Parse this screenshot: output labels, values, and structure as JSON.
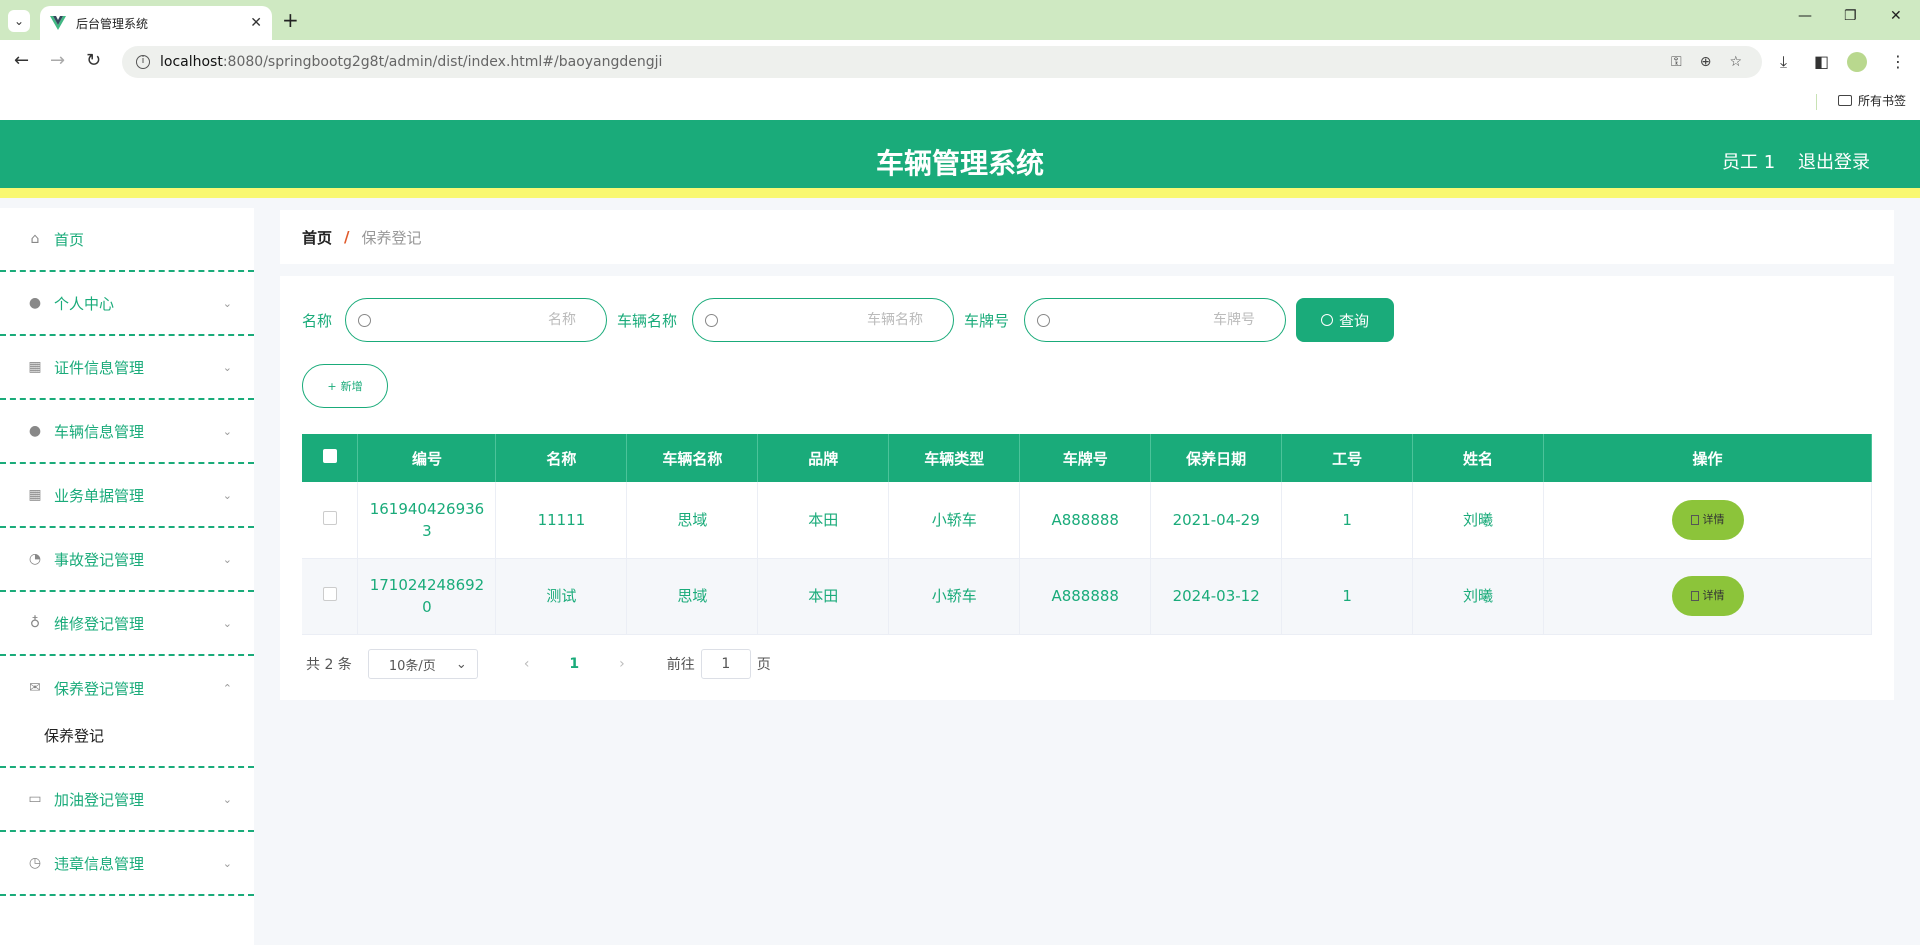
{
  "browser": {
    "tab_title": "后台管理系统",
    "url_host": "localhost",
    "url_path": ":8080/springbootg2g8t/admin/dist/index.html#/baoyangdengji",
    "bookmarks_label": "所有书签"
  },
  "header": {
    "title": "车辆管理系统",
    "user": "员工 1",
    "logout": "退出登录"
  },
  "sidebar": {
    "items": [
      {
        "label": "首页",
        "icon": "home-icon"
      },
      {
        "label": "个人中心",
        "icon": "user-icon"
      },
      {
        "label": "证件信息管理",
        "icon": "grid-icon"
      },
      {
        "label": "车辆信息管理",
        "icon": "user-icon"
      },
      {
        "label": "业务单据管理",
        "icon": "grid-icon"
      },
      {
        "label": "事故登记管理",
        "icon": "gauge-icon"
      },
      {
        "label": "维修登记管理",
        "icon": "mic-icon"
      },
      {
        "label": "保养登记管理",
        "icon": "mail-icon"
      },
      {
        "label": "加油登记管理",
        "icon": "chat-icon"
      },
      {
        "label": "违章信息管理",
        "icon": "compass-icon"
      }
    ],
    "submenu_label": "保养登记"
  },
  "breadcrumb": {
    "home": "首页",
    "separator": "/",
    "current": "保养登记"
  },
  "search": {
    "name_label": "名称",
    "name_placeholder": "名称",
    "vehicle_label": "车辆名称",
    "vehicle_placeholder": "车辆名称",
    "plate_label": "车牌号",
    "plate_placeholder": "车牌号",
    "query_button": "查询"
  },
  "add_button": "新增",
  "table": {
    "headers": [
      "编号",
      "名称",
      "车辆名称",
      "品牌",
      "车辆类型",
      "车牌号",
      "保养日期",
      "工号",
      "姓名",
      "操作"
    ],
    "rows": [
      {
        "id": "1619404269363",
        "name": "11111",
        "vehicle": "思域",
        "brand": "本田",
        "type": "小轿车",
        "plate": "A888888",
        "date": "2021-04-29",
        "empno": "1",
        "person": "刘曦"
      },
      {
        "id": "1710242486920",
        "name": "测试",
        "vehicle": "思域",
        "brand": "本田",
        "type": "小轿车",
        "plate": "A888888",
        "date": "2024-03-12",
        "empno": "1",
        "person": "刘曦"
      }
    ],
    "detail_button": "详情"
  },
  "pagination": {
    "total": "共 2 条",
    "page_size": "10条/页",
    "current_page": "1",
    "goto_label": "前往",
    "goto_value": "1",
    "page_suffix": "页"
  }
}
